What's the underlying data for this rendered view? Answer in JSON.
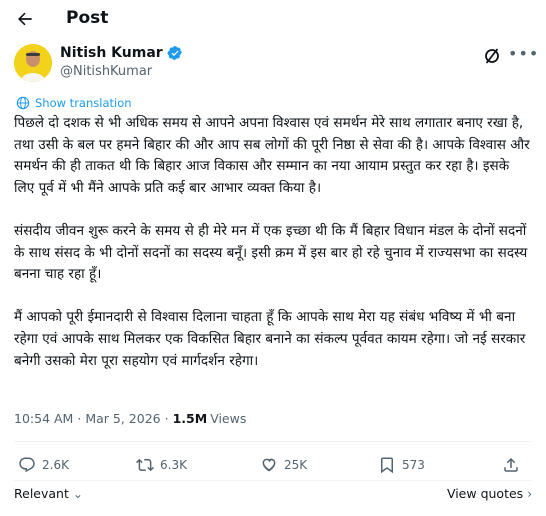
{
  "header": {
    "title": "Post"
  },
  "author": {
    "name": "Nitish Kumar",
    "handle": "@NitishKumar"
  },
  "translate": {
    "label": "Show translation"
  },
  "post": {
    "paragraphs": [
      "पिछले दो दशक से भी अधिक समय से आपने अपना विश्वास एवं समर्थन मेरे साथ लगातार बनाए रखा है, तथा उसी के बल पर हमने बिहार की और आप सब लोगों की पूरी निष्ठा से सेवा की है। आपके विश्वास और समर्थन की ही ताकत थी कि बिहार आज विकास और सम्मान का नया आयाम प्रस्तुत कर रहा है। इसके लिए पूर्व में भी मैंने आपके प्रति कई बार आभार व्यक्त किया है।",
      "संसदीय जीवन शुरू करने के समय से ही मेरे मन में एक इच्छा थी कि मैं बिहार विधान मंडल के दोनों सदनों के साथ संसद के भी दोनों सदनों का सदस्य बनूँ। इसी क्रम में इस बार हो रहे चुनाव में राज्यसभा का सदस्य बनना चाह रहा हूँ।",
      "मैं आपको पूरी ईमानदारी से विश्वास दिलाना चाहता हूँ कि आपके साथ मेरा यह संबंध भविष्य में भी बना रहेगा एवं आपके साथ मिलकर एक विकसित बिहार बनाने का संकल्प पूर्ववत कायम रहेगा। जो नई सरकार बनेगी उसको मेरा पूरा सहयोग एवं मार्गदर्शन रहेगा।"
    ]
  },
  "meta": {
    "time": "10:54 AM",
    "date": "Mar 5, 2026",
    "views_count": "1.5M",
    "views_label": "Views"
  },
  "actions": {
    "replies": "2.6K",
    "reposts": "6.3K",
    "likes": "25K",
    "bookmarks": "573"
  },
  "footer": {
    "relevant_label": "Relevant",
    "view_quotes_label": "View quotes"
  },
  "colors": {
    "accent": "#1d9bf0",
    "text": "#0f1419",
    "muted": "#536471",
    "verified": "#1d9bf0",
    "avatar_bg": "#f2d21a"
  },
  "icons": {
    "back": "arrow-left-icon",
    "verified": "verified-badge-icon",
    "grok": "grok-icon",
    "more": "more-icon",
    "translate": "translate-icon",
    "reply": "reply-icon",
    "repost": "repost-icon",
    "like": "heart-icon",
    "bookmark": "bookmark-icon",
    "share": "share-icon"
  }
}
